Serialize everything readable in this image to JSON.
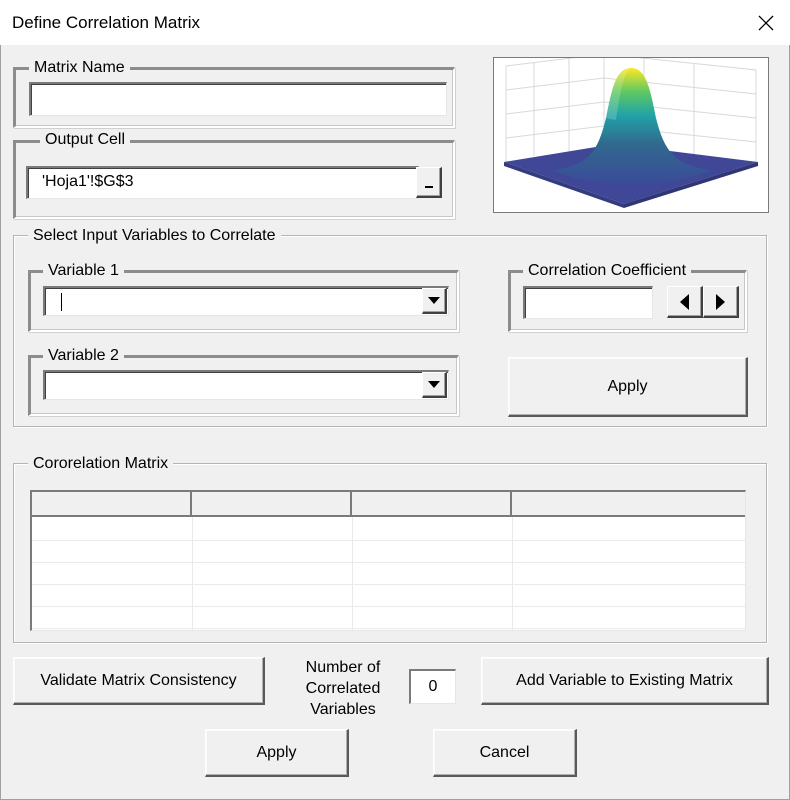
{
  "window": {
    "title": "Define Correlation Matrix",
    "close_icon": "close-icon"
  },
  "matrix_name": {
    "label": "Matrix Name",
    "value": ""
  },
  "output_cell": {
    "label": "Output Cell",
    "value": "'Hoja1'!$G$3",
    "ref_button_glyph": "_"
  },
  "preview": {
    "icon": "surface-3d-plot-icon",
    "colors": [
      "#3b4a9a",
      "#31688e",
      "#21a3a7",
      "#5ec962",
      "#fde725"
    ]
  },
  "select_group": {
    "label": "Select Input Variables to Correlate",
    "variable1": {
      "label": "Variable 1",
      "value": ""
    },
    "variable2": {
      "label": "Variable 2",
      "value": ""
    },
    "coefficient": {
      "label": "Correlation Coefficient",
      "value": ""
    },
    "apply_label": "Apply"
  },
  "matrix_group": {
    "label": "Cororelation Matrix",
    "columns": [
      "",
      "",
      "",
      ""
    ],
    "rows": [
      [
        "",
        "",
        "",
        ""
      ],
      [
        "",
        "",
        "",
        ""
      ],
      [
        "",
        "",
        "",
        ""
      ],
      [
        "",
        "",
        "",
        ""
      ],
      [
        "",
        "",
        "",
        ""
      ]
    ]
  },
  "footer": {
    "validate_label": "Validate Matrix Consistency",
    "count_label": "Number of Correlated Variables",
    "count_value": "0",
    "add_variable_label": "Add Variable to Existing Matrix",
    "apply_label": "Apply",
    "cancel_label": "Cancel"
  }
}
